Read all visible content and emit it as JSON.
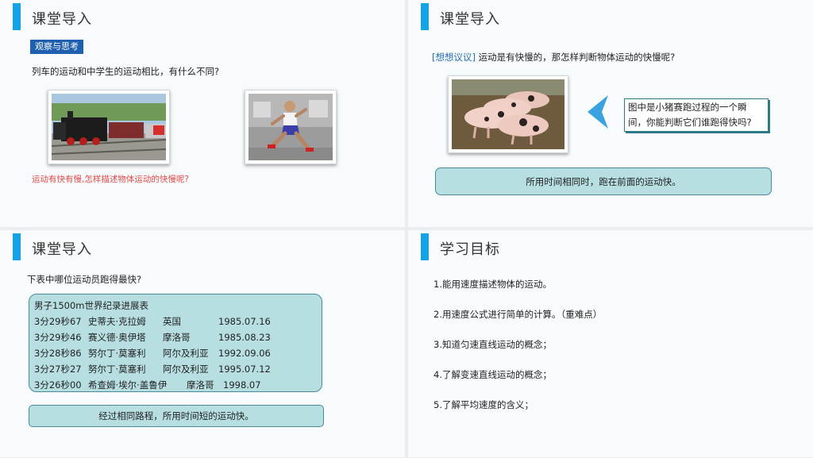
{
  "slide1": {
    "title": "课堂导入",
    "tag": "观察与思考",
    "question": "列车的运动和中学生的运动相比，有什么不同?",
    "note": "运动有快有慢,怎样描述物体运动的快慢呢?"
  },
  "slide2": {
    "title": "课堂导入",
    "question_prefix": "[想想议议]",
    "question": "运动是有快慢的，那怎样判断物体运动的快慢呢?",
    "callout": "图中是小猪赛跑过程的一个瞬间，你能判断它们谁跑得快吗?",
    "answer": "所用时间相同时，跑在前面的运动快。"
  },
  "slide3": {
    "title": "课堂导入",
    "question": "下表中哪位运动员跑得最快?",
    "table_title": "男子1500m世界纪录进展表",
    "records": [
      {
        "time": "3分29秒67",
        "name": "史蒂夫·克拉姆",
        "country": "英国",
        "date": "1985.07.16"
      },
      {
        "time": "3分29秒46",
        "name": "赛义德·奥伊塔",
        "country": "摩洛哥",
        "date": "1985.08.23"
      },
      {
        "time": "3分28秒86",
        "name": "努尔丁·莫塞利",
        "country": "阿尔及利亚",
        "date": "1992.09.06"
      },
      {
        "time": "3分27秒27",
        "name": "努尔丁·莫塞利",
        "country": "阿尔及利亚",
        "date": "1995.07.12"
      },
      {
        "time": "3分26秒00",
        "name": "希查姆·埃尔·盖鲁伊",
        "country": "摩洛哥",
        "date": "1998.07"
      }
    ],
    "answer": "经过相同路程，所用时间短的运动快。"
  },
  "slide4": {
    "title": "学习目标",
    "goals": [
      "1.能用速度描述物体的运动。",
      "2.用速度公式进行简单的计算。（重难点）",
      "3.知道匀速直线运动的概念；",
      "4.了解变速直线运动的概念；",
      "5.了解平均速度的含义；"
    ]
  }
}
